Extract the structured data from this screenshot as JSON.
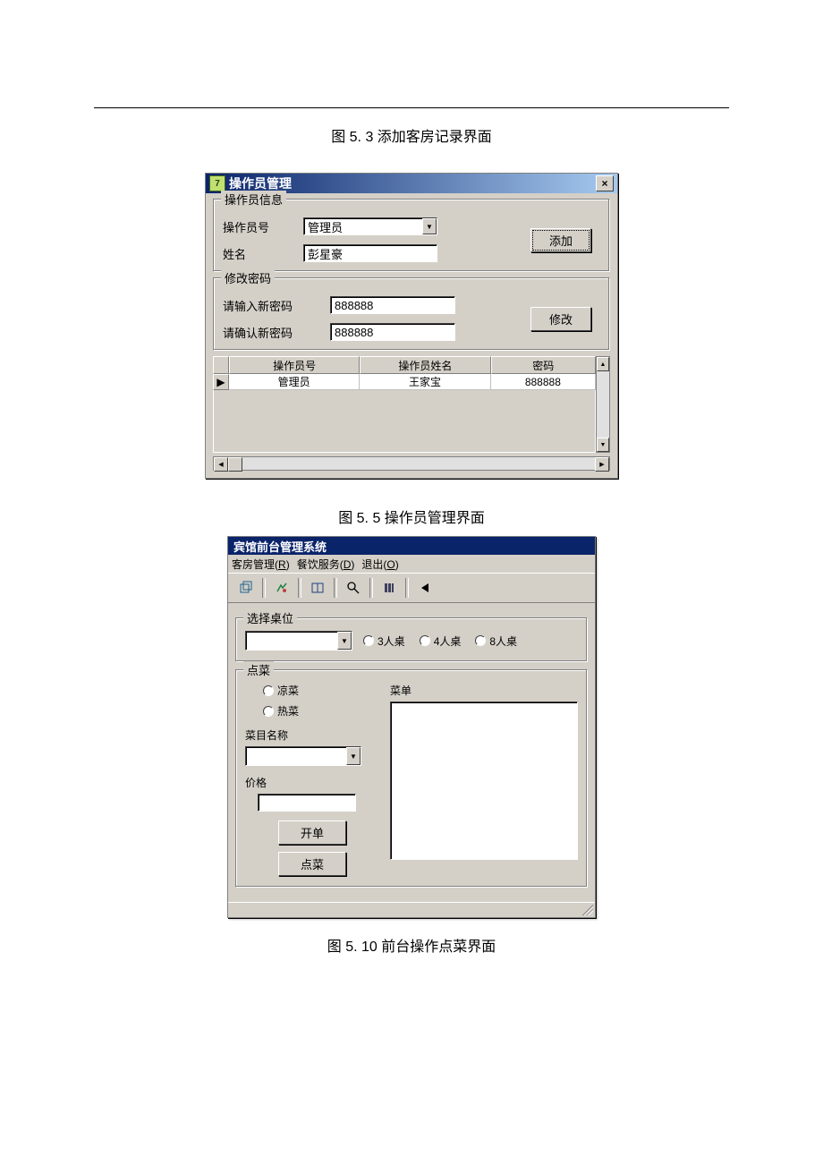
{
  "captions": {
    "fig5_3": "图 5. 3 添加客房记录界面",
    "fig5_5": "图 5. 5 操作员管理界面",
    "fig5_10": "图 5. 10 前台操作点菜界面"
  },
  "window1": {
    "title": "操作员管理",
    "group1": {
      "legend": "操作员信息",
      "operator_id_label": "操作员号",
      "operator_id_value": "管理员",
      "name_label": "姓名",
      "name_value": "彭星豪",
      "add_button": "添加"
    },
    "group2": {
      "legend": "修改密码",
      "new_pw_label": "请输入新密码",
      "new_pw_value": "888888",
      "confirm_pw_label": "请确认新密码",
      "confirm_pw_value": "888888",
      "modify_button": "修改"
    },
    "grid": {
      "headers": [
        "操作员号",
        "操作员姓名",
        "密码"
      ],
      "row": [
        "管理员",
        "王家宝",
        "888888"
      ]
    }
  },
  "window2": {
    "title": "宾馆前台管理系统",
    "menu": {
      "room": "客房管理",
      "room_key": "R",
      "dining": "餐饮服务",
      "dining_key": "D",
      "exit": "退出",
      "exit_key": "O"
    },
    "table_group": {
      "legend": "选择桌位",
      "radios": [
        "3人桌",
        "4人桌",
        "8人桌"
      ]
    },
    "order_group": {
      "legend": "点菜",
      "category_cold": "凉菜",
      "category_hot": "热菜",
      "dish_name_label": "菜目名称",
      "price_label": "价格",
      "open_order_button": "开单",
      "order_dish_button": "点菜",
      "menu_label": "菜单"
    }
  }
}
